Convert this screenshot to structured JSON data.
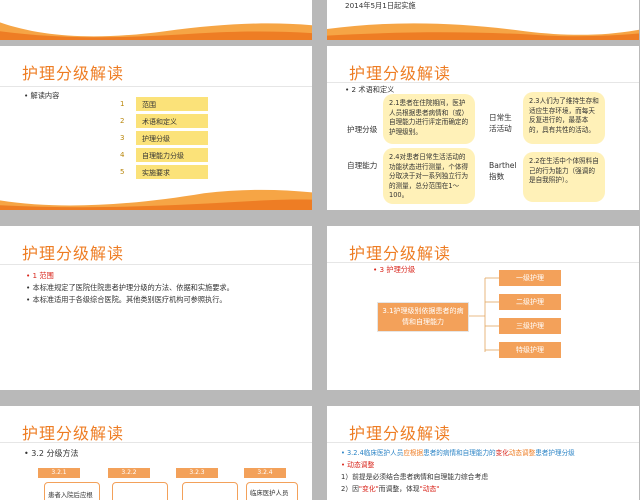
{
  "slides": {
    "s1": {
      "header_line": ""
    },
    "s2": {
      "line": "2014年5月1日起实施"
    },
    "s3": {
      "title": "护理分级解读",
      "intro": "• 解读内容",
      "items": [
        {
          "num": "1",
          "label": "范围"
        },
        {
          "num": "2",
          "label": "术语和定义"
        },
        {
          "num": "3",
          "label": "护理分级"
        },
        {
          "num": "4",
          "label": "自理能力分级"
        },
        {
          "num": "5",
          "label": "实施要求"
        }
      ]
    },
    "s4": {
      "title": "护理分级解读",
      "section": "• 2  术语和定义",
      "terms": {
        "care_level": "护理分级",
        "self_care": "自理能力",
        "adl": "日常生活活动",
        "barthel": "Barthel指数"
      },
      "defs": {
        "d21": "2.1患者在住院期间，医护人员根据患者病情和（或）自理能力进行评定而确定的护理级别。",
        "d24": "2.4对患者日常生活活动的功能状态进行测量，个体得分取决于对一系列独立行为的测量，总分范围在1～100。",
        "d23": "2.3人们为了维持生存和适应生存环境，而每天反复进行的，最基本的，具有共性的活动。",
        "d22": "2.2在生活中个体照料自己的行为能力（强调的是自我照护）。"
      }
    },
    "s5": {
      "title": "护理分级解读",
      "sec": "1  范围",
      "p1": "• 本标准规定了医院住院患者护理分级的方法、依据和实施要求。",
      "p2": "• 本标准适用于各级综合医院。其他类别医疗机构可参照执行。"
    },
    "s6": {
      "title": "护理分级解读",
      "sec": "3  护理分级",
      "main": "3.1护理级别依据患者的病情和自理能力",
      "levels": [
        "一级护理",
        "二级护理",
        "三级护理",
        "特级护理"
      ]
    },
    "s7": {
      "title": "护理分级解读",
      "sec": "• 3.2  分级方法",
      "tabs": [
        "3.2.1",
        "3.2.2",
        "3.2.3",
        "3.2.4"
      ],
      "box1": "患者入院后应根",
      "box4": "临床医护人员"
    },
    "s8": {
      "title": "护理分级解读",
      "l1a": "• 3.2.4临床医护人员",
      "l1b": "应根据",
      "l1c": "患者的病情和自理能力的",
      "l1d": "变化",
      "l1e": "动态调整",
      "l1f": "患者护理分级",
      "l2": "• 动态调整",
      "l3": "1）前提是必须结合患者病情和自理能力综合考虑",
      "l4a": "2）因",
      "l4b": "\"变化\"",
      "l4c": "而调整，体现",
      "l4d": "\"动态\""
    }
  },
  "colors": {
    "accent": "#ee7d24",
    "yellow": "#fbe279",
    "orange_box": "#f3a15a"
  }
}
